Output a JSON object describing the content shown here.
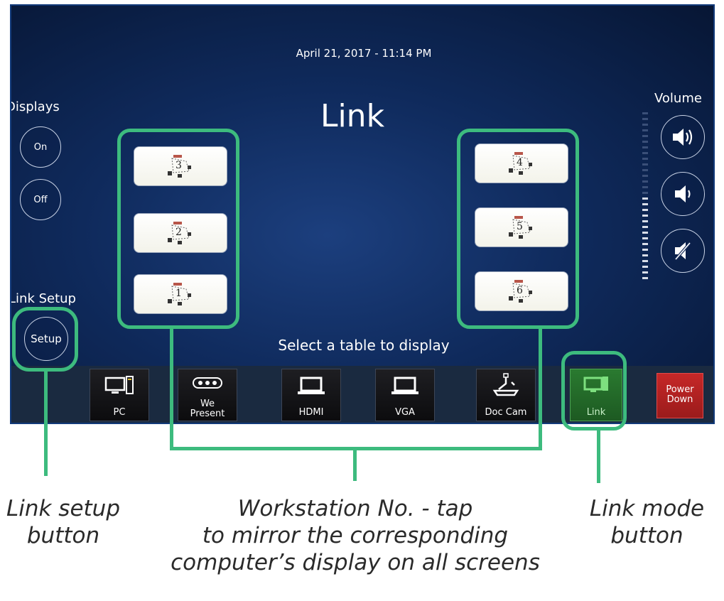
{
  "screen": {
    "datetime": "April 21, 2017 - 11:14 PM",
    "title": "Link",
    "left_panel": {
      "displays_label": "Displays",
      "on_label": "On",
      "off_label": "Off",
      "link_setup_label": "Link Setup",
      "setup_label": "Setup"
    },
    "volume": {
      "label": "Volume",
      "level": 0.5,
      "buttons": [
        "volume-up-icon",
        "volume-down-icon",
        "mute-icon"
      ]
    },
    "workstations": {
      "left": [
        "3",
        "2",
        "1"
      ],
      "right": [
        "4",
        "5",
        "6"
      ]
    },
    "select_message": "Select a table to display",
    "sources": [
      {
        "label": "PC",
        "icon": "desktop-computer-icon"
      },
      {
        "label": "We\nPresent",
        "icon": "wepresent-icon"
      },
      {
        "label": "HDMI",
        "icon": "laptop-icon"
      },
      {
        "label": "VGA",
        "icon": "laptop-icon"
      },
      {
        "label": "Doc Cam",
        "icon": "document-camera-icon"
      },
      {
        "label": "Link",
        "icon": "link-monitor-icon"
      },
      {
        "label": "Power\nDown",
        "icon": ""
      }
    ],
    "accent_color": "#3dbb7e"
  },
  "annotations": {
    "link_setup": "Link setup\nbutton",
    "workstation": "Workstation No. - tap\nto mirror the corresponding\ncomputer’s display on all screens",
    "link_mode": "Link mode\nbutton"
  }
}
